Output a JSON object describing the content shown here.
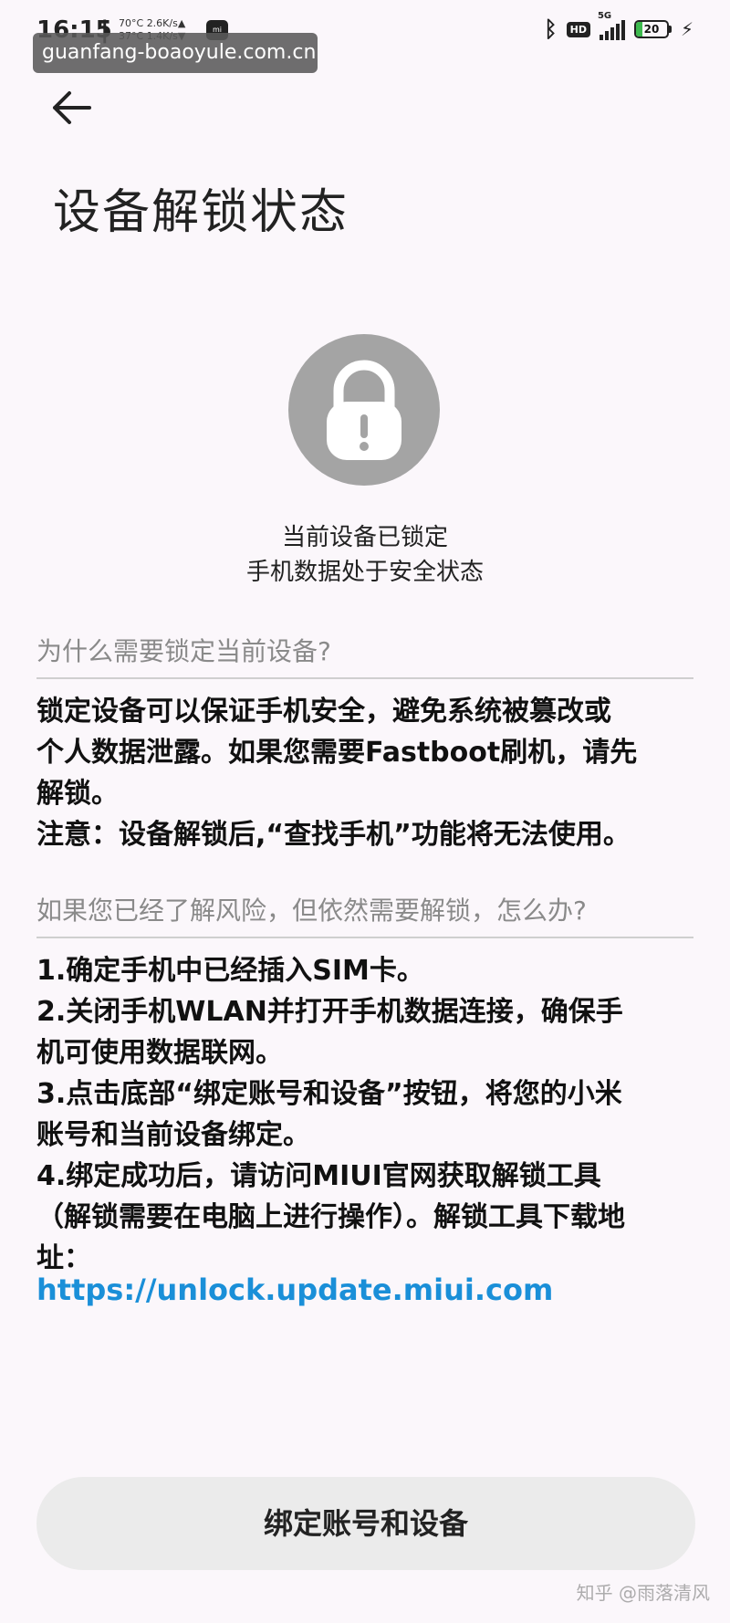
{
  "status_bar": {
    "time": "16:15",
    "separator": "|",
    "temp_top": "70°C",
    "speed_top": "2.6K/s▲",
    "temp_bottom": "37°C",
    "speed_bottom": "1.4K/s▼",
    "app_icon_label": "mi",
    "hd_label": "HD",
    "network_label": "5G",
    "battery_level": 20,
    "battery_text": "20",
    "icons": [
      "bluetooth-icon",
      "signal-icon",
      "battery-icon",
      "charging-icon"
    ]
  },
  "watermark_url": "guanfang-boaoyule.com.cn",
  "header": {
    "back_icon": "arrow-left-icon",
    "title": "设备解锁状态"
  },
  "lock_status": {
    "icon": "padlock-warning-icon",
    "line1": "当前设备已锁定",
    "line2": "手机数据处于安全状态"
  },
  "section_why": {
    "heading": "为什么需要锁定当前设备?",
    "lines": [
      "锁定设备可以保证手机安全，避免系统被篡改或",
      "个人数据泄露。如果您需要Fastboot刷机，请先",
      "解锁。",
      "注意：设备解锁后,“查找手机”功能将无法使用。"
    ]
  },
  "section_how": {
    "heading": "如果您已经了解风险，但依然需要解锁，怎么办?",
    "lines": [
      "1.确定手机中已经插入SIM卡。",
      "2.关闭手机WLAN并打开手机数据连接，确保手",
      "机可使用数据联网。",
      "3.点击底部“绑定账号和设备”按钮，将您的小米",
      "账号和当前设备绑定。",
      "4.绑定成功后，请访问MIUI官网获取解锁工具",
      "（解锁需要在电脑上进行操作）。解锁工具下载地",
      "址："
    ],
    "link": "https://unlock.update.miui.com"
  },
  "bind_button": {
    "label": "绑定账号和设备"
  },
  "credit_watermark": "知乎 @雨落清风"
}
